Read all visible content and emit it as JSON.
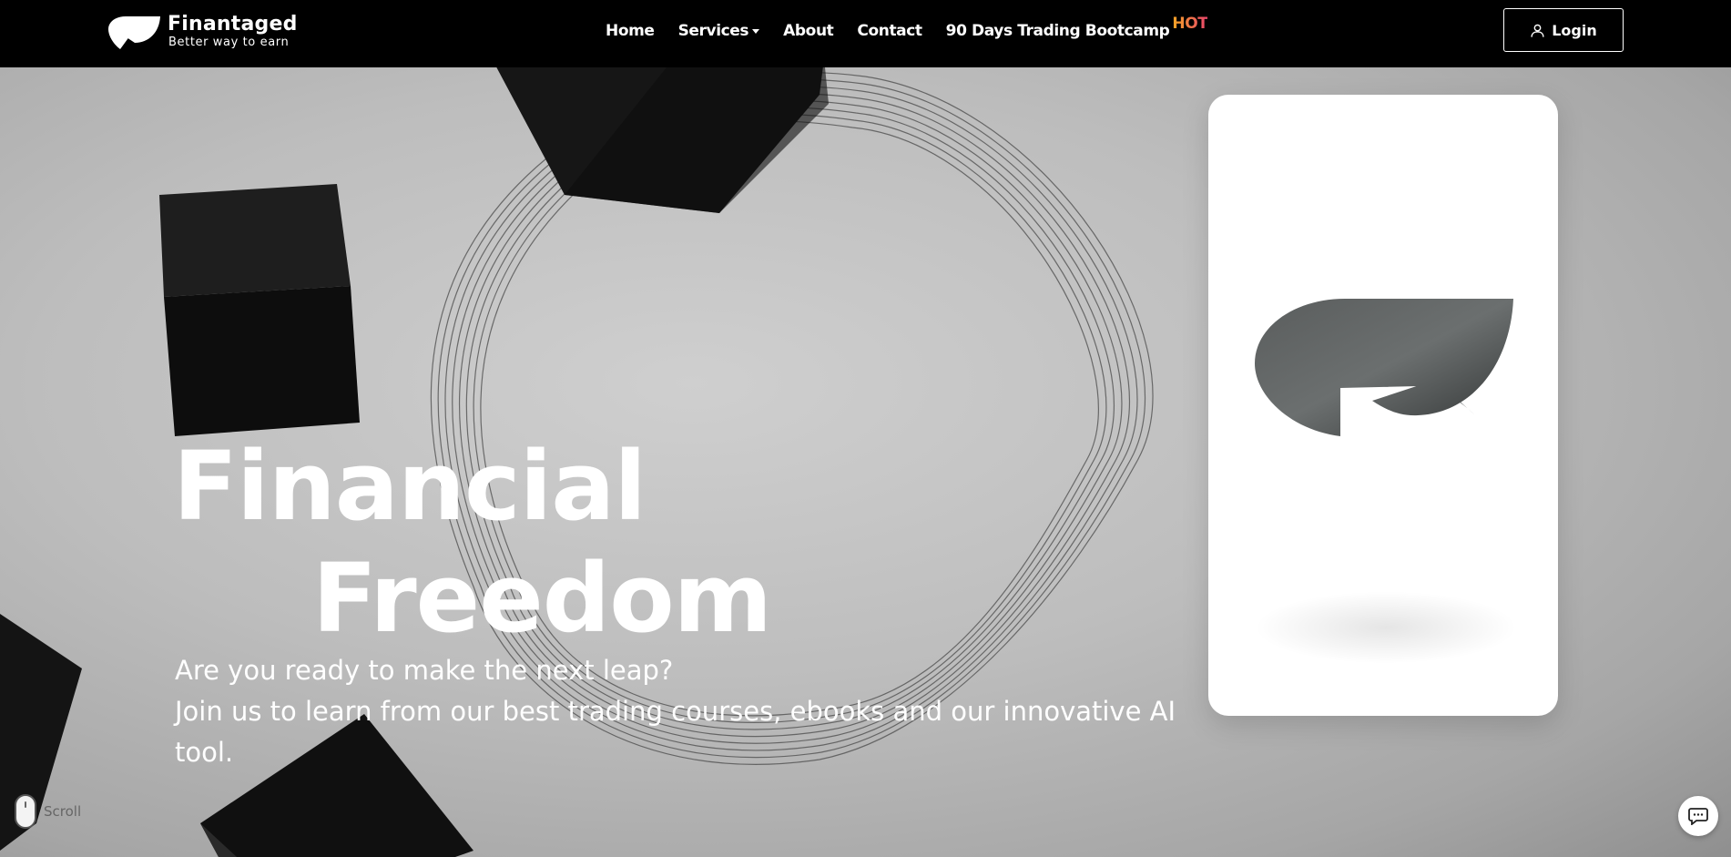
{
  "brand": {
    "name": "Finantaged",
    "tagline": "Better way to earn",
    "icon": "leaf-logo-icon"
  },
  "nav": {
    "items": [
      {
        "label": "Home"
      },
      {
        "label": "Services",
        "has_dropdown": true
      },
      {
        "label": "About"
      },
      {
        "label": "Contact"
      },
      {
        "label": "90 Days Trading Bootcamp",
        "badge": "HOT"
      }
    ]
  },
  "login": {
    "label": "Login",
    "icon": "user-icon"
  },
  "hero": {
    "title_line1": "Financial",
    "title_line2": "Freedom",
    "subtitle_line1": "Are you ready to make the next leap?",
    "subtitle_line2": "Join us to learn from our best trading courses, ebooks and our innovative AI tool.",
    "card_icon": "finantaged-logo-icon"
  },
  "scroll": {
    "label": "Scroll",
    "icon": "mouse-icon"
  },
  "chat": {
    "icon": "chat-bubble-icon"
  },
  "colors": {
    "navbar_bg": "#000000",
    "hot_gradient_start": "#f5a623",
    "hot_gradient_end": "#e8456b",
    "hero_text": "#ffffff"
  }
}
